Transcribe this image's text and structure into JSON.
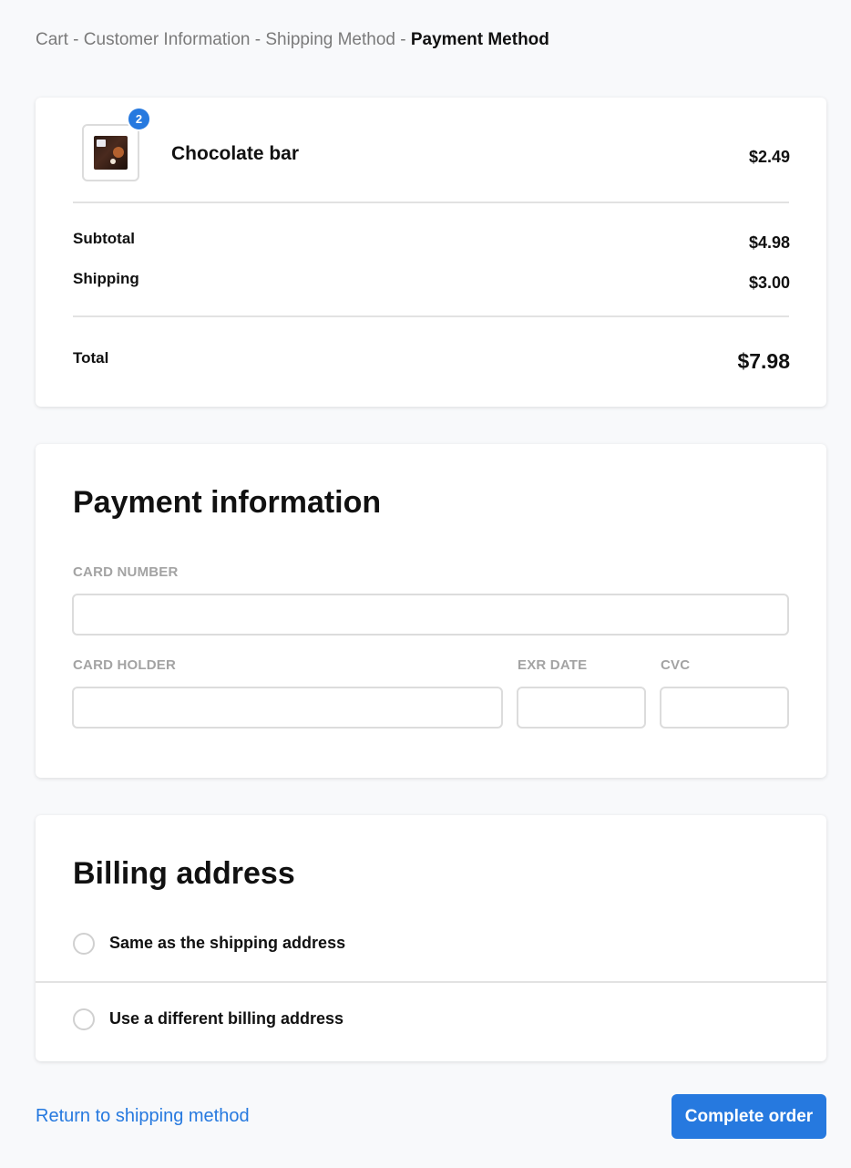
{
  "breadcrumb": {
    "steps": [
      "Cart",
      "Customer Information",
      "Shipping Method"
    ],
    "separator": " - ",
    "current": "Payment Method"
  },
  "summary": {
    "item": {
      "name": "Chocolate bar",
      "price": "$2.49",
      "quantity": "2",
      "image_icon": "chocolate-bar-image"
    },
    "subtotal_label": "Subtotal",
    "subtotal_value": "$4.98",
    "shipping_label": "Shipping",
    "shipping_value": "$3.00",
    "total_label": "Total",
    "total_value": "$7.98"
  },
  "payment": {
    "title": "Payment information",
    "card_number_label": "CARD NUMBER",
    "card_number_value": "",
    "card_holder_label": "CARD HOLDER",
    "card_holder_value": "",
    "exp_date_label": "EXR DATE",
    "exp_date_value": "",
    "cvc_label": "CVC",
    "cvc_value": ""
  },
  "billing": {
    "title": "Billing address",
    "options": [
      {
        "label": "Same as the shipping address",
        "selected": false
      },
      {
        "label": "Use a different billing address",
        "selected": false
      }
    ]
  },
  "footer": {
    "return_link": "Return to shipping method",
    "complete_button": "Complete order"
  },
  "colors": {
    "accent": "#2679df",
    "background": "#f8f9fb",
    "muted_label": "#a3a3a3"
  }
}
